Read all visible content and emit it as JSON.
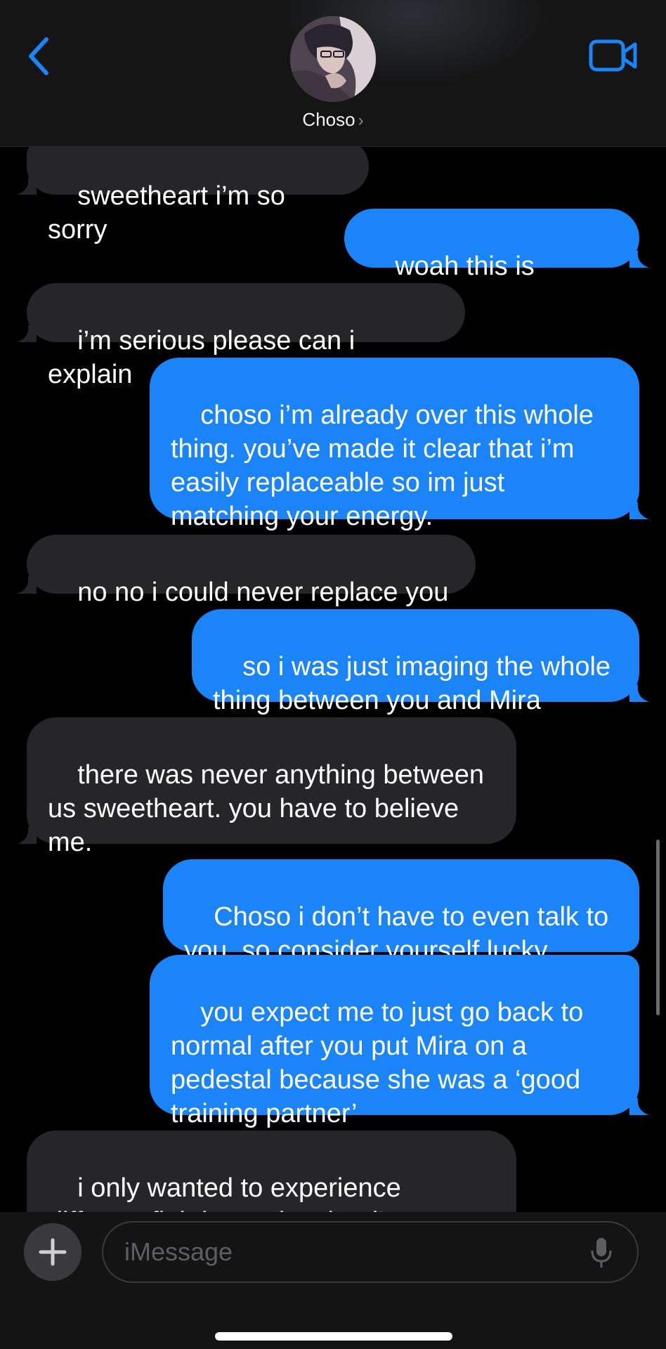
{
  "header": {
    "contact_name": "Choso",
    "chevron": "›"
  },
  "icons": {
    "back": "chevron-left-icon",
    "video": "video-camera-icon",
    "plus": "plus-icon",
    "mic": "microphone-icon"
  },
  "colors": {
    "accent": "#1a84f8",
    "incoming_bubble": "#262628",
    "background": "#000000"
  },
  "messages": [
    {
      "direction": "in",
      "text": "sweetheart i’m so sorry"
    },
    {
      "direction": "out",
      "text": "woah this is sudden"
    },
    {
      "direction": "in",
      "text": "i’m serious please can i explain"
    },
    {
      "direction": "out",
      "text": "choso i’m already over this whole thing. you’ve made it clear that i’m easily replaceable so im just matching your energy."
    },
    {
      "direction": "in",
      "text": "no no i could never replace you"
    },
    {
      "direction": "out",
      "text": "so i was just imaging the whole thing between you and Mira"
    },
    {
      "direction": "in",
      "text": "there was never anything between us sweetheart. you have to believe me."
    },
    {
      "direction": "out",
      "text": "Choso i don’t have to even talk to you. so consider yourself lucky."
    },
    {
      "direction": "out",
      "text": "you expect me to just go back to normal after you put Mira on a pedestal because she was a ‘good training partner’"
    },
    {
      "direction": "in",
      "text": "i only wanted to experience different fighting styles, but i’m"
    }
  ],
  "composer": {
    "placeholder": "iMessage",
    "value": ""
  }
}
